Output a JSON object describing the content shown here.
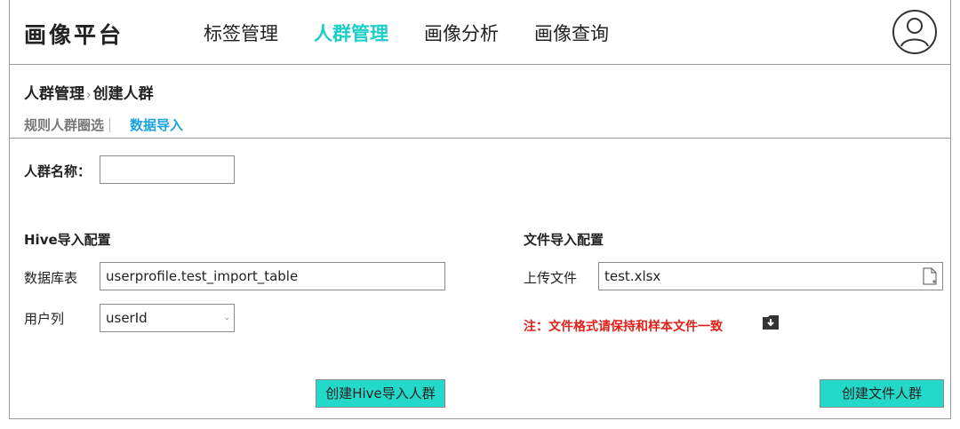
{
  "header": {
    "logo": "画像平台",
    "nav": [
      "标签管理",
      "人群管理",
      "画像分析",
      "画像查询"
    ],
    "active_nav": "人群管理"
  },
  "breadcrumb": {
    "parent": "人群管理",
    "separator": "›",
    "current": "创建人群"
  },
  "subtabs": {
    "rule": "规则人群圈选",
    "import": "数据导入"
  },
  "form": {
    "name_label": "人群名称：",
    "name_value": ""
  },
  "hive": {
    "section_title": "Hive导入配置",
    "table_label": "数据库表",
    "table_value": "userprofile.test_import_table",
    "user_col_label": "用户列",
    "user_col_value": "userId",
    "create_button": "创建Hive导入人群"
  },
  "file": {
    "section_title": "文件导入配置",
    "upload_label": "上传文件",
    "upload_value": "test.xlsx",
    "note": "注：文件格式请保持和样本文件一致",
    "create_button": "创建文件人群"
  },
  "colors": {
    "accent": "#1bcfc8",
    "tab_active": "#1aa3e0",
    "button_bg": "#23d9c9",
    "note_red": "#e0211b"
  },
  "icons": {
    "avatar": "user-avatar-icon",
    "select": "chevron-down-icon",
    "file": "file-icon",
    "download": "download-icon"
  }
}
